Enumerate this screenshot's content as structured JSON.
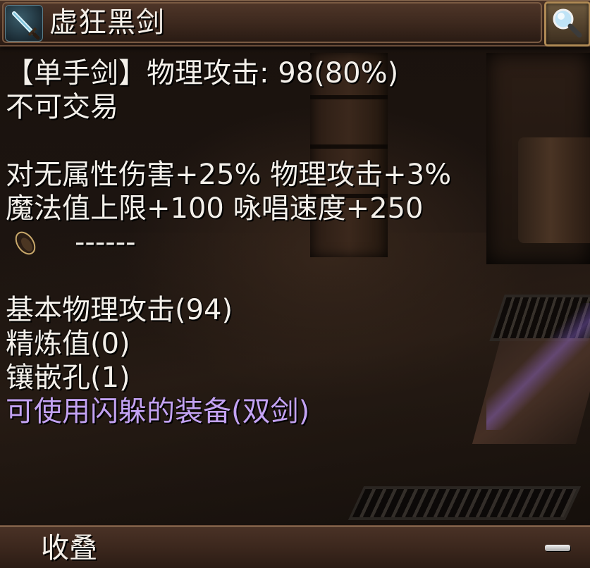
{
  "window": {
    "title": "虚狂黑剑",
    "icons": {
      "item": "sword-icon",
      "search": "magnifier-icon",
      "collapse": "minus-icon",
      "card_slot": "card-slot-icon"
    }
  },
  "description": {
    "type_line": "【单手剑】物理攻击: 98(80%)",
    "trade_line": "不可交易",
    "effect_line_1": "对无属性伤害+25% 物理攻击+3%",
    "effect_line_2": "魔法值上限+100 咏唱速度+250",
    "card_slot_text": "------",
    "base_attack": "基本物理攻击(94)",
    "refine": "精炼值(0)",
    "slots": "镶嵌孔(1)",
    "dodge_note": "可使用闪躲的装备(双剑)"
  },
  "footer": {
    "collapse_label": "收叠"
  },
  "colors": {
    "text": "#f4f0ea",
    "special_text": "#c3a2f2",
    "frame": "#4a3226"
  }
}
